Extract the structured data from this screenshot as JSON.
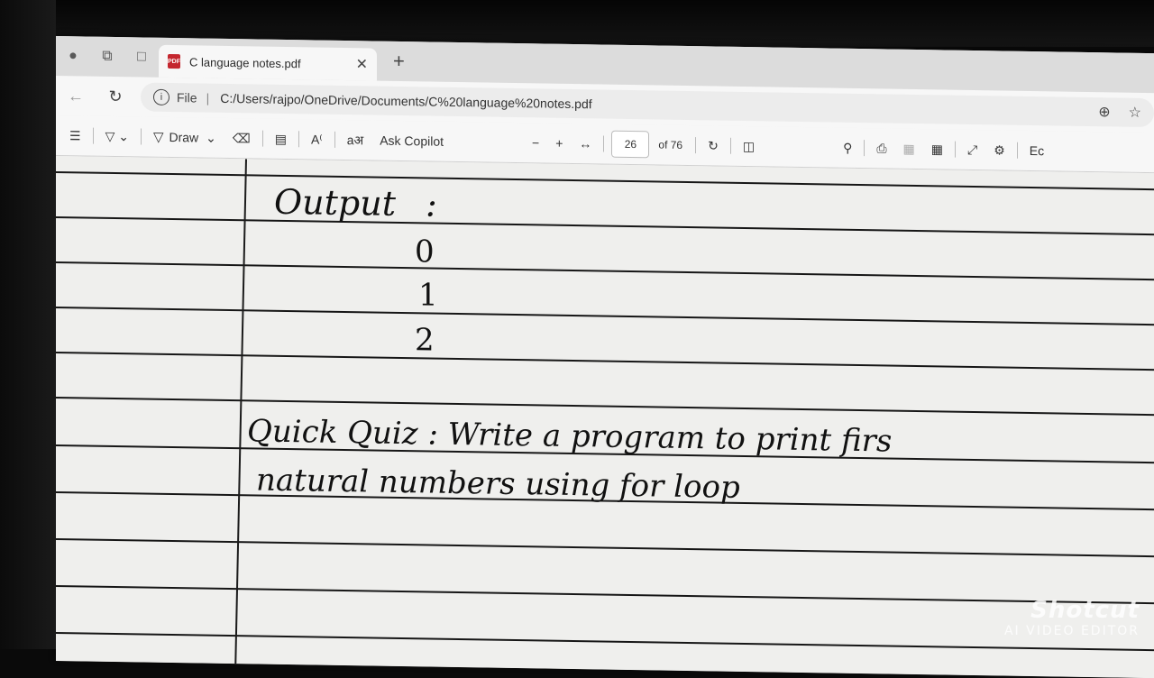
{
  "tab": {
    "title": "C language notes.pdf",
    "pdf_badge": "PDF"
  },
  "address": {
    "scheme_label": "File",
    "url": "C:/Users/rajpo/OneDrive/Documents/C%20language%20notes.pdf"
  },
  "toolbar": {
    "draw_label": "Draw",
    "copilot_label": "Ask Copilot",
    "page_current": "26",
    "page_total": "of 76",
    "edge_cut": "Ec"
  },
  "page": {
    "output_heading": "Output",
    "colon": ":",
    "outputs": [
      "0",
      "1",
      "2"
    ],
    "quiz_line1": "Quick Quiz :  Write  a  program  to  print  firs",
    "quiz_line2": "natural   numbers   using   for loop"
  },
  "watermark": {
    "brand": "Shotcut",
    "sub": "AI VIDEO EDITOR"
  },
  "icons": [
    "profile-icon",
    "workspaces-icon",
    "tab-actions-icon",
    "pdf-icon",
    "close-icon",
    "new-tab-icon",
    "back-icon",
    "reload-icon",
    "info-icon",
    "zoom-icon",
    "favorite-icon",
    "contents-icon",
    "highlight-icon",
    "draw-icon",
    "erase-icon",
    "text-icon",
    "read-aloud-icon",
    "translate-icon",
    "zoom-out-icon",
    "zoom-in-icon",
    "fit-width-icon",
    "rotate-icon",
    "page-view-icon",
    "search-icon",
    "print-icon",
    "save-icon",
    "save-as-icon",
    "fullscreen-icon",
    "settings-icon"
  ]
}
